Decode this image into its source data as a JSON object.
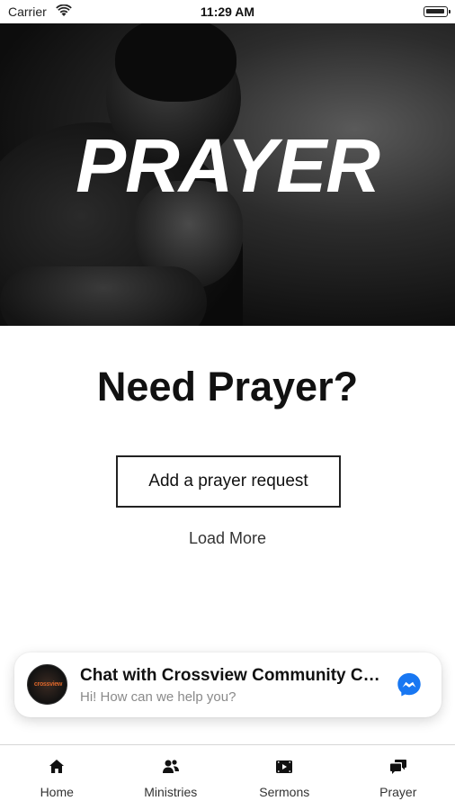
{
  "status_bar": {
    "carrier": "Carrier",
    "time": "11:29 AM"
  },
  "hero": {
    "title": "PRAYER"
  },
  "main": {
    "heading": "Need Prayer?",
    "add_request_label": "Add a prayer request",
    "load_more_label": "Load More"
  },
  "chat": {
    "title": "Chat with Crossview Community Church",
    "subtitle": "Hi! How can we help you?",
    "avatar_text": "crossview",
    "accent_color": "#1877F2"
  },
  "tab_bar": {
    "tabs": [
      {
        "label": "Home",
        "icon": "home-icon"
      },
      {
        "label": "Ministries",
        "icon": "people-icon"
      },
      {
        "label": "Sermons",
        "icon": "video-icon"
      },
      {
        "label": "Prayer",
        "icon": "chat-bubbles-icon"
      }
    ]
  }
}
